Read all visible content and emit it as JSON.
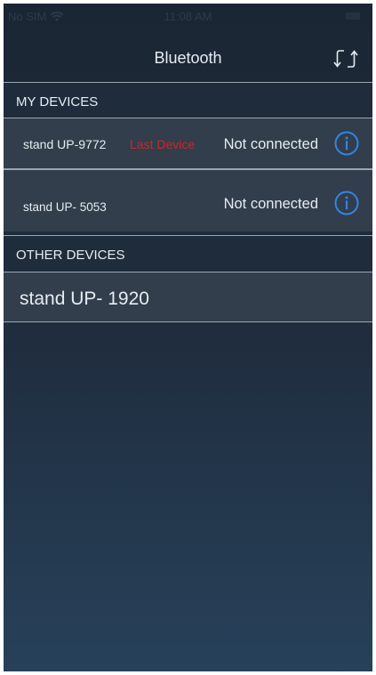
{
  "status_bar": {
    "carrier": "No SIM",
    "wifi_icon": "wifi-icon",
    "time": "11:08 AM",
    "battery_icon": "battery-icon"
  },
  "nav": {
    "title": "Bluetooth",
    "refresh_icon": "refresh-icon"
  },
  "my_devices": {
    "header": "MY DEVICES",
    "items": [
      {
        "name": "stand UP-9772",
        "tag": "Last Device",
        "status": "Not connected",
        "info_icon": "info-icon"
      },
      {
        "name": "stand UP- 5053",
        "tag": "",
        "status": "Not connected",
        "info_icon": "info-icon"
      }
    ]
  },
  "other_devices": {
    "header": "OTHER DEVICES",
    "items": [
      {
        "name": "stand UP- 1920"
      }
    ]
  },
  "colors": {
    "accent_blue": "#2f86ea",
    "last_device_red": "#d0232a",
    "text_light": "#e6ecf2",
    "row_bg": "#323e4b",
    "header_bg": "#1f2c3b"
  }
}
